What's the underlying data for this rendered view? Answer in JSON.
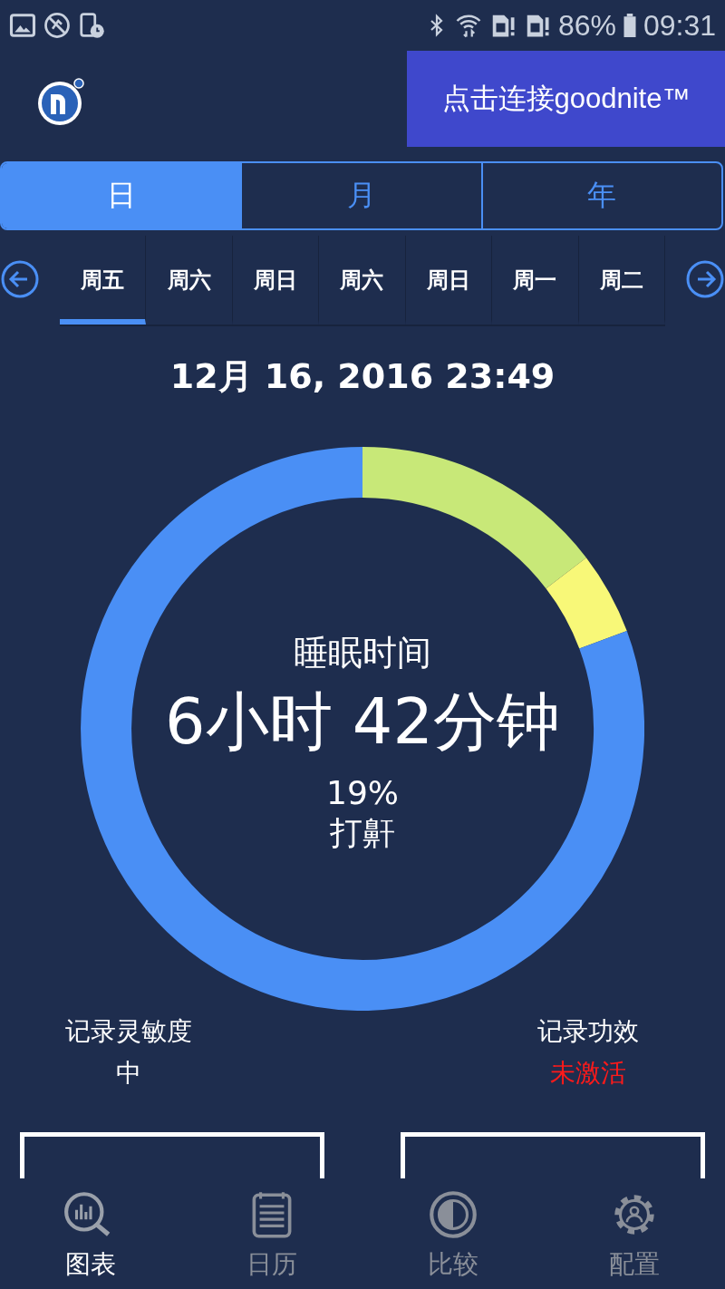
{
  "status_bar": {
    "battery": "86%",
    "time": "09:31"
  },
  "header": {
    "connect_button": "点击连接goodnite™"
  },
  "tabs": [
    {
      "label": "日",
      "selected": true
    },
    {
      "label": "月",
      "selected": false
    },
    {
      "label": "年",
      "selected": false
    }
  ],
  "days": [
    {
      "label": "周五",
      "selected": true
    },
    {
      "label": "周六",
      "selected": false
    },
    {
      "label": "周日",
      "selected": false
    },
    {
      "label": "周六",
      "selected": false
    },
    {
      "label": "周日",
      "selected": false
    },
    {
      "label": "周一",
      "selected": false
    },
    {
      "label": "周二",
      "selected": false
    }
  ],
  "date": "12月 16, 2016 23:49",
  "summary": {
    "title": "睡眠时间",
    "duration": "6小时 42分钟",
    "percent": "19%",
    "percent_label": "打鼾"
  },
  "stats": [
    {
      "label": "记录灵敏度",
      "value": "中",
      "kind": "normal"
    },
    {
      "label": "记录功效",
      "value": "未激活",
      "kind": "alert"
    }
  ],
  "nav": [
    {
      "label": "图表",
      "kind": "chart",
      "selected": true
    },
    {
      "label": "日历",
      "kind": "calendar",
      "selected": false
    },
    {
      "label": "比较",
      "kind": "compare",
      "selected": false
    },
    {
      "label": "配置",
      "kind": "settings",
      "selected": false
    }
  ]
}
